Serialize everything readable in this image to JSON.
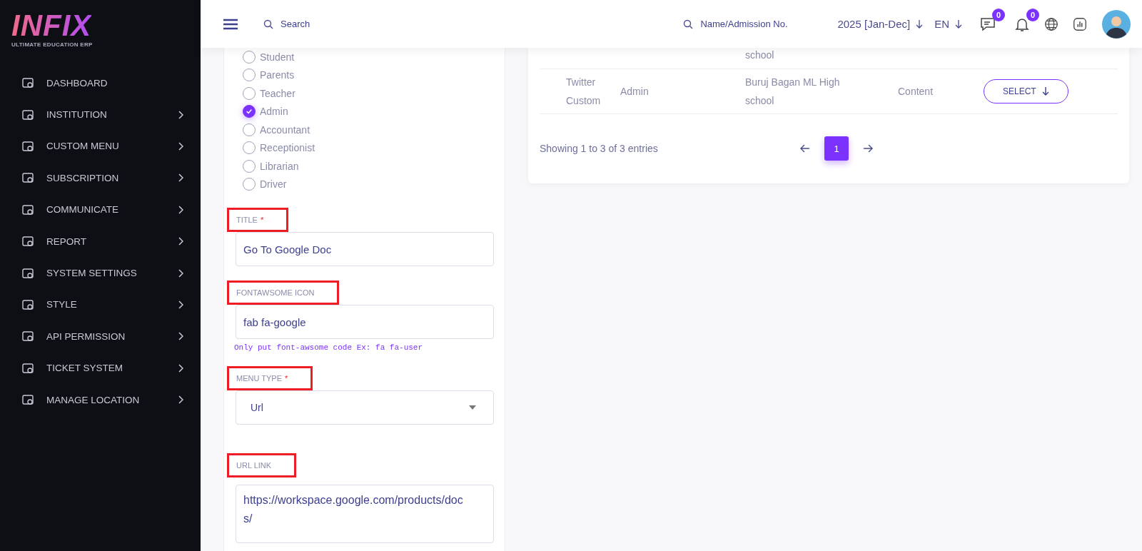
{
  "sidebar": {
    "logo": "INFIX",
    "tagline": "ULTIMATE EDUCATION ERP",
    "items": [
      {
        "label": "DASHBOARD",
        "has_submenu": false
      },
      {
        "label": "INSTITUTION",
        "has_submenu": true
      },
      {
        "label": "CUSTOM MENU",
        "has_submenu": true
      },
      {
        "label": "SUBSCRIPTION",
        "has_submenu": true
      },
      {
        "label": "COMMUNICATE",
        "has_submenu": true
      },
      {
        "label": "REPORT",
        "has_submenu": true
      },
      {
        "label": "SYSTEM SETTINGS",
        "has_submenu": true
      },
      {
        "label": "STYLE",
        "has_submenu": true
      },
      {
        "label": "API PERMISSION",
        "has_submenu": true
      },
      {
        "label": "TICKET SYSTEM",
        "has_submenu": true
      },
      {
        "label": "MANAGE LOCATION",
        "has_submenu": true
      }
    ]
  },
  "header": {
    "search": {
      "placeholder": "Search"
    },
    "student_search": {
      "placeholder": "Name/Admission No."
    },
    "session": "2025 [Jan-Dec]",
    "language": "EN",
    "messages_count": "0",
    "notifications_count": "0"
  },
  "form": {
    "roles": [
      {
        "label": "Student",
        "checked": false
      },
      {
        "label": "Parents",
        "checked": false
      },
      {
        "label": "Teacher",
        "checked": false
      },
      {
        "label": "Admin",
        "checked": true
      },
      {
        "label": "Accountant",
        "checked": false
      },
      {
        "label": "Receptionist",
        "checked": false
      },
      {
        "label": "Librarian",
        "checked": false
      },
      {
        "label": "Driver",
        "checked": false
      }
    ],
    "fields": [
      {
        "kind": "text",
        "label": "TITLE",
        "required_mark": "*",
        "value": "Go To Google Doc"
      },
      {
        "kind": "text",
        "label": "FONTAWSOME ICON",
        "value": "fab fa-google",
        "hint": "Only put font-awsome code Ex: fa fa-user"
      },
      {
        "kind": "select",
        "label": "MENU TYPE",
        "required_mark": "*",
        "value": "Url"
      },
      {
        "kind": "textarea",
        "label": "URL LINK",
        "value": "https://workspace.google.com/products/docs/"
      }
    ]
  },
  "table": {
    "rows": [
      {
        "column_3": "school"
      },
      {
        "column_1": "Twitter Custom",
        "column_2": "Admin",
        "column_3": "Buruj Bagan ML High school",
        "column_4": "Content",
        "button": "SELECT"
      }
    ],
    "summary": "Showing 1 to 3 of 3 entries",
    "pages": [
      {
        "label": "1",
        "selected": true
      }
    ]
  }
}
